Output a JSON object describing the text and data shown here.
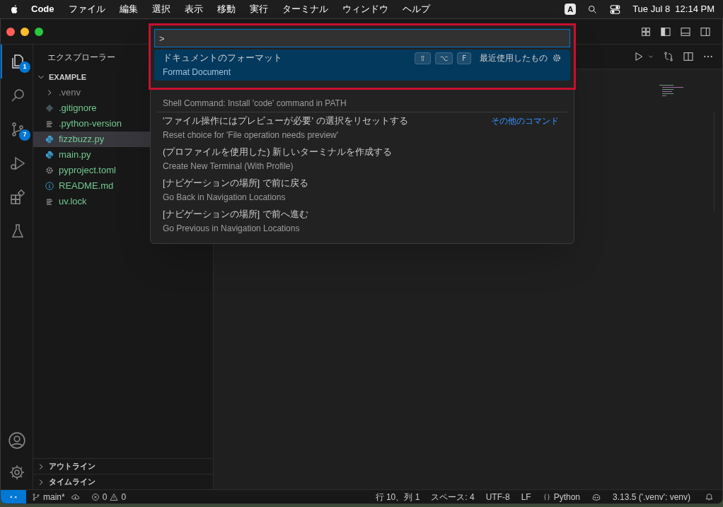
{
  "menubar": {
    "app": "Code",
    "menus": [
      "ファイル",
      "編集",
      "選択",
      "表示",
      "移動",
      "実行",
      "ターミナル",
      "ウィンドウ",
      "ヘルプ"
    ],
    "input_indicator": "A",
    "clock": "Tue Jul 8  12:14 PM"
  },
  "activity_bar": [
    {
      "kind": "explorer",
      "selected": true,
      "badge": "1"
    },
    {
      "kind": "search",
      "selected": false
    },
    {
      "kind": "source-control",
      "selected": false,
      "badge": "7"
    },
    {
      "kind": "debug",
      "selected": false
    },
    {
      "kind": "extensions",
      "selected": false
    },
    {
      "kind": "testing",
      "selected": false
    }
  ],
  "sidebar": {
    "title": "エクスプローラー",
    "folder": {
      "label": "EXAMPLE",
      "expanded": true,
      "children": [
        {
          "label": ".venv",
          "kind": "folder",
          "expanded": false,
          "untracked": false,
          "selected": false
        },
        {
          "label": ".gitignore",
          "kind": "git",
          "untracked": true,
          "selected": false
        },
        {
          "label": ".python-version",
          "kind": "text",
          "untracked": true,
          "selected": false
        },
        {
          "label": "fizzbuzz.py",
          "kind": "python",
          "untracked": true,
          "selected": true
        },
        {
          "label": "main.py",
          "kind": "python",
          "untracked": true,
          "selected": false
        },
        {
          "label": "pyproject.toml",
          "kind": "gear",
          "untracked": true,
          "selected": false
        },
        {
          "label": "README.md",
          "kind": "info",
          "untracked": true,
          "selected": false
        },
        {
          "label": "uv.lock",
          "kind": "text",
          "untracked": true,
          "selected": false
        }
      ]
    },
    "sections": [
      {
        "label": "アウトライン",
        "expanded": false
      },
      {
        "label": "タイムライン",
        "expanded": false
      }
    ]
  },
  "command_palette": {
    "value": ">",
    "items": [
      {
        "label": "ドキュメントのフォーマット",
        "detail": "Format Document",
        "keys": [
          "⇧",
          "⌥",
          "F"
        ],
        "recent": "最近使用したもの",
        "selected": true
      },
      {
        "detail": "Shell Command: Install 'code' command in PATH",
        "selected": false
      },
      {
        "label": "'ファイル操作にはプレビューが必要' の選択をリセットする",
        "detail": "Reset choice for 'File operation needs preview'",
        "aside": "その他のコマンド",
        "separator": true,
        "selected": false
      },
      {
        "label": "(プロファイルを使用した) 新しいターミナルを作成する",
        "detail": "Create New Terminal (With Profile)",
        "selected": false
      },
      {
        "label": "[ナビゲーションの場所] で前に戻る",
        "detail": "Go Back in Navigation Locations",
        "selected": false
      },
      {
        "label": "[ナビゲーションの場所] で前へ進む",
        "detail": "Go Previous in Navigation Locations",
        "selected": false
      }
    ]
  },
  "status_bar": {
    "branch": "main*",
    "errors": "0",
    "warnings": "0",
    "position": "行 10、列 1",
    "indent": "スペース: 4",
    "encoding": "UTF-8",
    "eol": "LF",
    "language": "Python",
    "interpreter": "3.13.5 ('.venv': venv)"
  }
}
